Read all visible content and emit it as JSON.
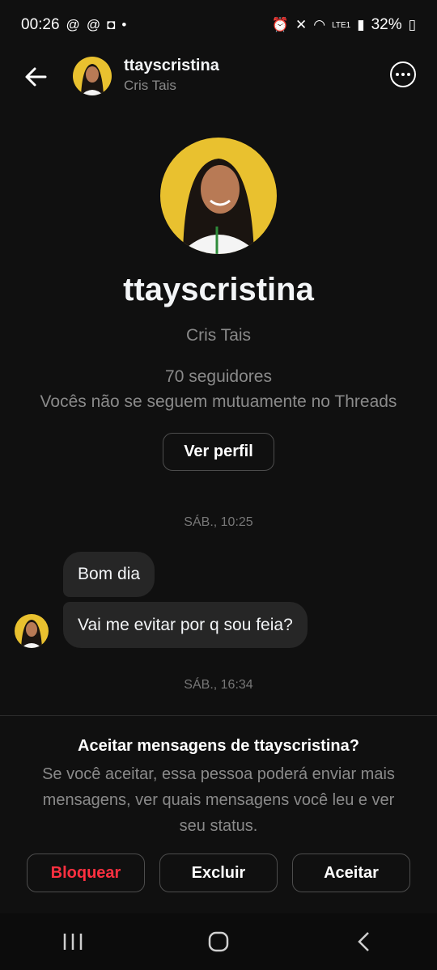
{
  "status_bar": {
    "time": "00:26",
    "battery": "32%",
    "network": "LTE1"
  },
  "header": {
    "username": "ttayscristina",
    "full_name": "Cris Tais"
  },
  "profile": {
    "username": "ttayscristina",
    "full_name": "Cris Tais",
    "followers": "70 seguidores",
    "mutual_text": "Vocês não se seguem mutuamente no Threads",
    "view_profile_label": "Ver perfil"
  },
  "messages": {
    "timestamp_1": "SÁB., 10:25",
    "bubble_1": "Bom dia",
    "bubble_2": "Vai me evitar por q sou feia?",
    "timestamp_2": "SÁB., 16:34"
  },
  "accept_panel": {
    "title": "Aceitar mensagens de ttayscristina?",
    "body": "Se você aceitar, essa pessoa poderá enviar mais mensagens, ver quais mensagens você leu e ver seu status.",
    "block_label": "Bloquear",
    "delete_label": "Excluir",
    "accept_label": "Aceitar"
  },
  "colors": {
    "background": "#101010",
    "bubble": "#262626",
    "block_red": "#ff3040",
    "avatar_yellow": "#e9c12f"
  },
  "icons": [
    "back-arrow-icon",
    "more-options-icon",
    "recent-apps-icon",
    "home-icon",
    "system-back-icon"
  ]
}
